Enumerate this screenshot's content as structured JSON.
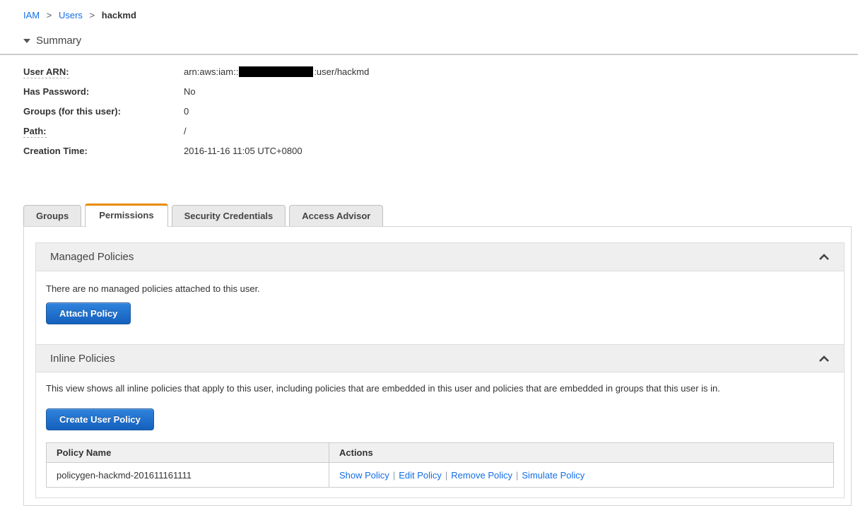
{
  "breadcrumb": {
    "items": [
      "IAM",
      "Users",
      "hackmd"
    ],
    "separator": ">"
  },
  "summary": {
    "title": "Summary",
    "fields": [
      {
        "label": "User ARN:",
        "value_prefix": "arn:aws:iam::",
        "value_suffix": ":user/hackmd",
        "redacted": true
      },
      {
        "label": "Has Password:",
        "value": "No"
      },
      {
        "label": "Groups (for this user):",
        "value": "0"
      },
      {
        "label": "Path:",
        "value": "/"
      },
      {
        "label": "Creation Time:",
        "value": "2016-11-16 11:05 UTC+0800"
      }
    ]
  },
  "tabs": [
    {
      "label": "Groups",
      "active": false
    },
    {
      "label": "Permissions",
      "active": true
    },
    {
      "label": "Security Credentials",
      "active": false
    },
    {
      "label": "Access Advisor",
      "active": false
    }
  ],
  "managed_policies": {
    "title": "Managed Policies",
    "empty_text": "There are no managed policies attached to this user.",
    "attach_button": "Attach Policy"
  },
  "inline_policies": {
    "title": "Inline Policies",
    "description": "This view shows all inline policies that apply to this user, including policies that are embedded in this user and policies that are embedded in groups that this user is in.",
    "create_button": "Create User Policy",
    "actions_separator": "|",
    "table": {
      "headers": [
        "Policy Name",
        "Actions"
      ],
      "rows": [
        {
          "policy_name": "policygen-hackmd-201611161111",
          "actions": [
            "Show Policy",
            "Edit Policy",
            "Remove Policy",
            "Simulate Policy"
          ]
        }
      ]
    }
  },
  "colors": {
    "accent_orange": "#e88b00",
    "link_blue": "#146ee6",
    "btn_top": "#2f83dc",
    "btn_bottom": "#1460bd",
    "redaction_black": "#000000"
  }
}
